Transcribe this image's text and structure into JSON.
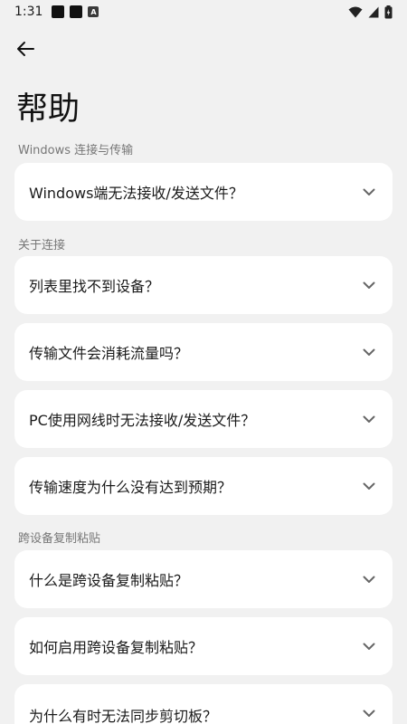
{
  "status_bar": {
    "time": "1:31",
    "notification_icons": [
      "square-notification-icon",
      "square-notification-icon",
      "a-notification-icon"
    ],
    "a_label": "A"
  },
  "header": {
    "back_icon": "arrow-left-icon",
    "title": "帮助"
  },
  "sections": [
    {
      "label": "Windows 连接与传输",
      "items": [
        "Windows端无法接收/发送文件？"
      ]
    },
    {
      "label": "关于连接",
      "items": [
        "列表里找不到设备？",
        "传输文件会消耗流量吗？",
        "PC使用网线时无法接收/发送文件？",
        "传输速度为什么没有达到预期？"
      ]
    },
    {
      "label": "跨设备复制粘贴",
      "items": [
        "什么是跨设备复制粘贴？",
        "如何启用跨设备复制粘贴？",
        "为什么有时无法同步剪切板？"
      ]
    }
  ],
  "colors": {
    "background": "#f1f1f1",
    "card": "#ffffff",
    "section_label": "#777777",
    "text": "#1a1a1a"
  }
}
